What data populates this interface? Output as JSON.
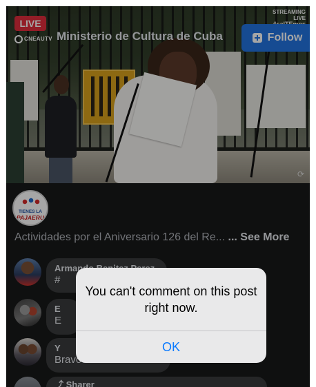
{
  "video": {
    "live_badge": "LIVE",
    "channel_logo": "CNEAUTV",
    "streaming_tag_line1": "STREAMING",
    "streaming_tag_line2": "LIVE",
    "streaming_tag_hashtag": "#salTEmos"
  },
  "page": {
    "name": "Ministerio de Cultura de Cuba",
    "avatar_text_top": "TIENES LA",
    "avatar_text_bottom": "PAJAERU",
    "follow_label": "Follow",
    "description": "Actividades por el Aniversario 126 del Re...",
    "see_more_label": "... See More"
  },
  "comments": [
    {
      "author": "Armando Benitez Perez",
      "text": "#"
    },
    {
      "author": "E",
      "text": "E"
    },
    {
      "author": "Y",
      "text": "Bravoooooo"
    },
    {
      "author": "Sharer",
      "text": ""
    }
  ],
  "alert": {
    "message": "You can't comment on this post right now.",
    "ok_label": "OK"
  },
  "colors": {
    "background": "#18191a",
    "follow_button": "#2374e1",
    "live_badge": "#e02d3c",
    "alert_action": "#0a7aff"
  }
}
